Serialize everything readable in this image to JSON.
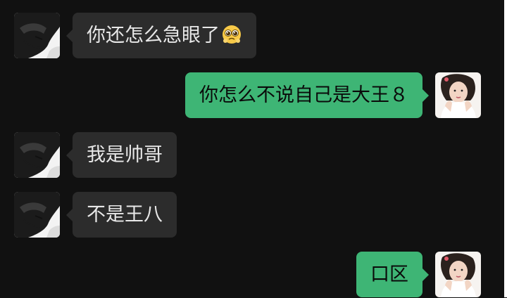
{
  "messages": [
    {
      "side": "left",
      "text": "你还怎么急眼了",
      "emoji": "pleading-face-icon"
    },
    {
      "side": "right",
      "text": "你怎么不说自己是大王８"
    },
    {
      "side": "left",
      "text": "我是帅哥"
    },
    {
      "side": "left",
      "text": "不是王八"
    },
    {
      "side": "right",
      "text": "口区"
    }
  ],
  "colors": {
    "background": "#111111",
    "incoming_bubble": "#2c2c2c",
    "outgoing_bubble": "#3eb575"
  }
}
